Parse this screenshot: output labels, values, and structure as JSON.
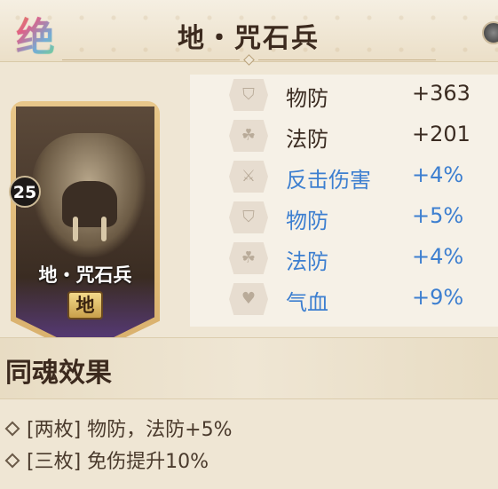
{
  "header": {
    "rarity_label": "绝",
    "title": "地・咒石兵"
  },
  "card": {
    "level": "25",
    "name": "地・咒石兵",
    "element": "地"
  },
  "stats": [
    {
      "icon": "physical-defense-icon",
      "name": "物防",
      "value": "+363",
      "type": "main"
    },
    {
      "icon": "magic-defense-icon",
      "name": "法防",
      "value": "+201",
      "type": "main"
    },
    {
      "icon": "counter-damage-icon",
      "name": "反击伤害",
      "value": "+4%",
      "type": "sub"
    },
    {
      "icon": "physical-defense-icon",
      "name": "物防",
      "value": "+5%",
      "type": "sub"
    },
    {
      "icon": "magic-defense-icon",
      "name": "法防",
      "value": "+4%",
      "type": "sub"
    },
    {
      "icon": "hp-icon",
      "name": "气血",
      "value": "+9%",
      "type": "sub"
    }
  ],
  "set_effect": {
    "title": "同魂效果",
    "items": [
      "[两枚] 物防，法防+5%",
      "[三枚] 免伤提升10%"
    ]
  }
}
